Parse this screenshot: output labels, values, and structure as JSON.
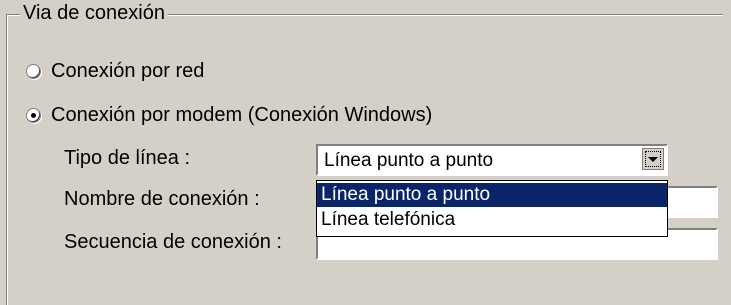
{
  "group": {
    "title": "Via de conexión"
  },
  "radios": [
    {
      "label": "Conexión por red",
      "selected": false
    },
    {
      "label": "Conexión por modem (Conexión Windows)",
      "selected": true
    }
  ],
  "fields": {
    "tipo_label": "Tipo de línea :",
    "nombre_label": "Nombre de conexión :",
    "secuencia_label": "Secuencia de conexión :",
    "tipo_value": "Línea punto a punto",
    "nombre_value": "",
    "secuencia_value": ""
  },
  "dropdown": {
    "options": [
      "Línea punto a punto",
      "Línea telefónica"
    ],
    "selected_index": 0
  },
  "icons": {
    "combo_arrow": "chevron-down-icon"
  },
  "colors": {
    "background": "#d4d0c8",
    "selection": "#0a246a"
  }
}
